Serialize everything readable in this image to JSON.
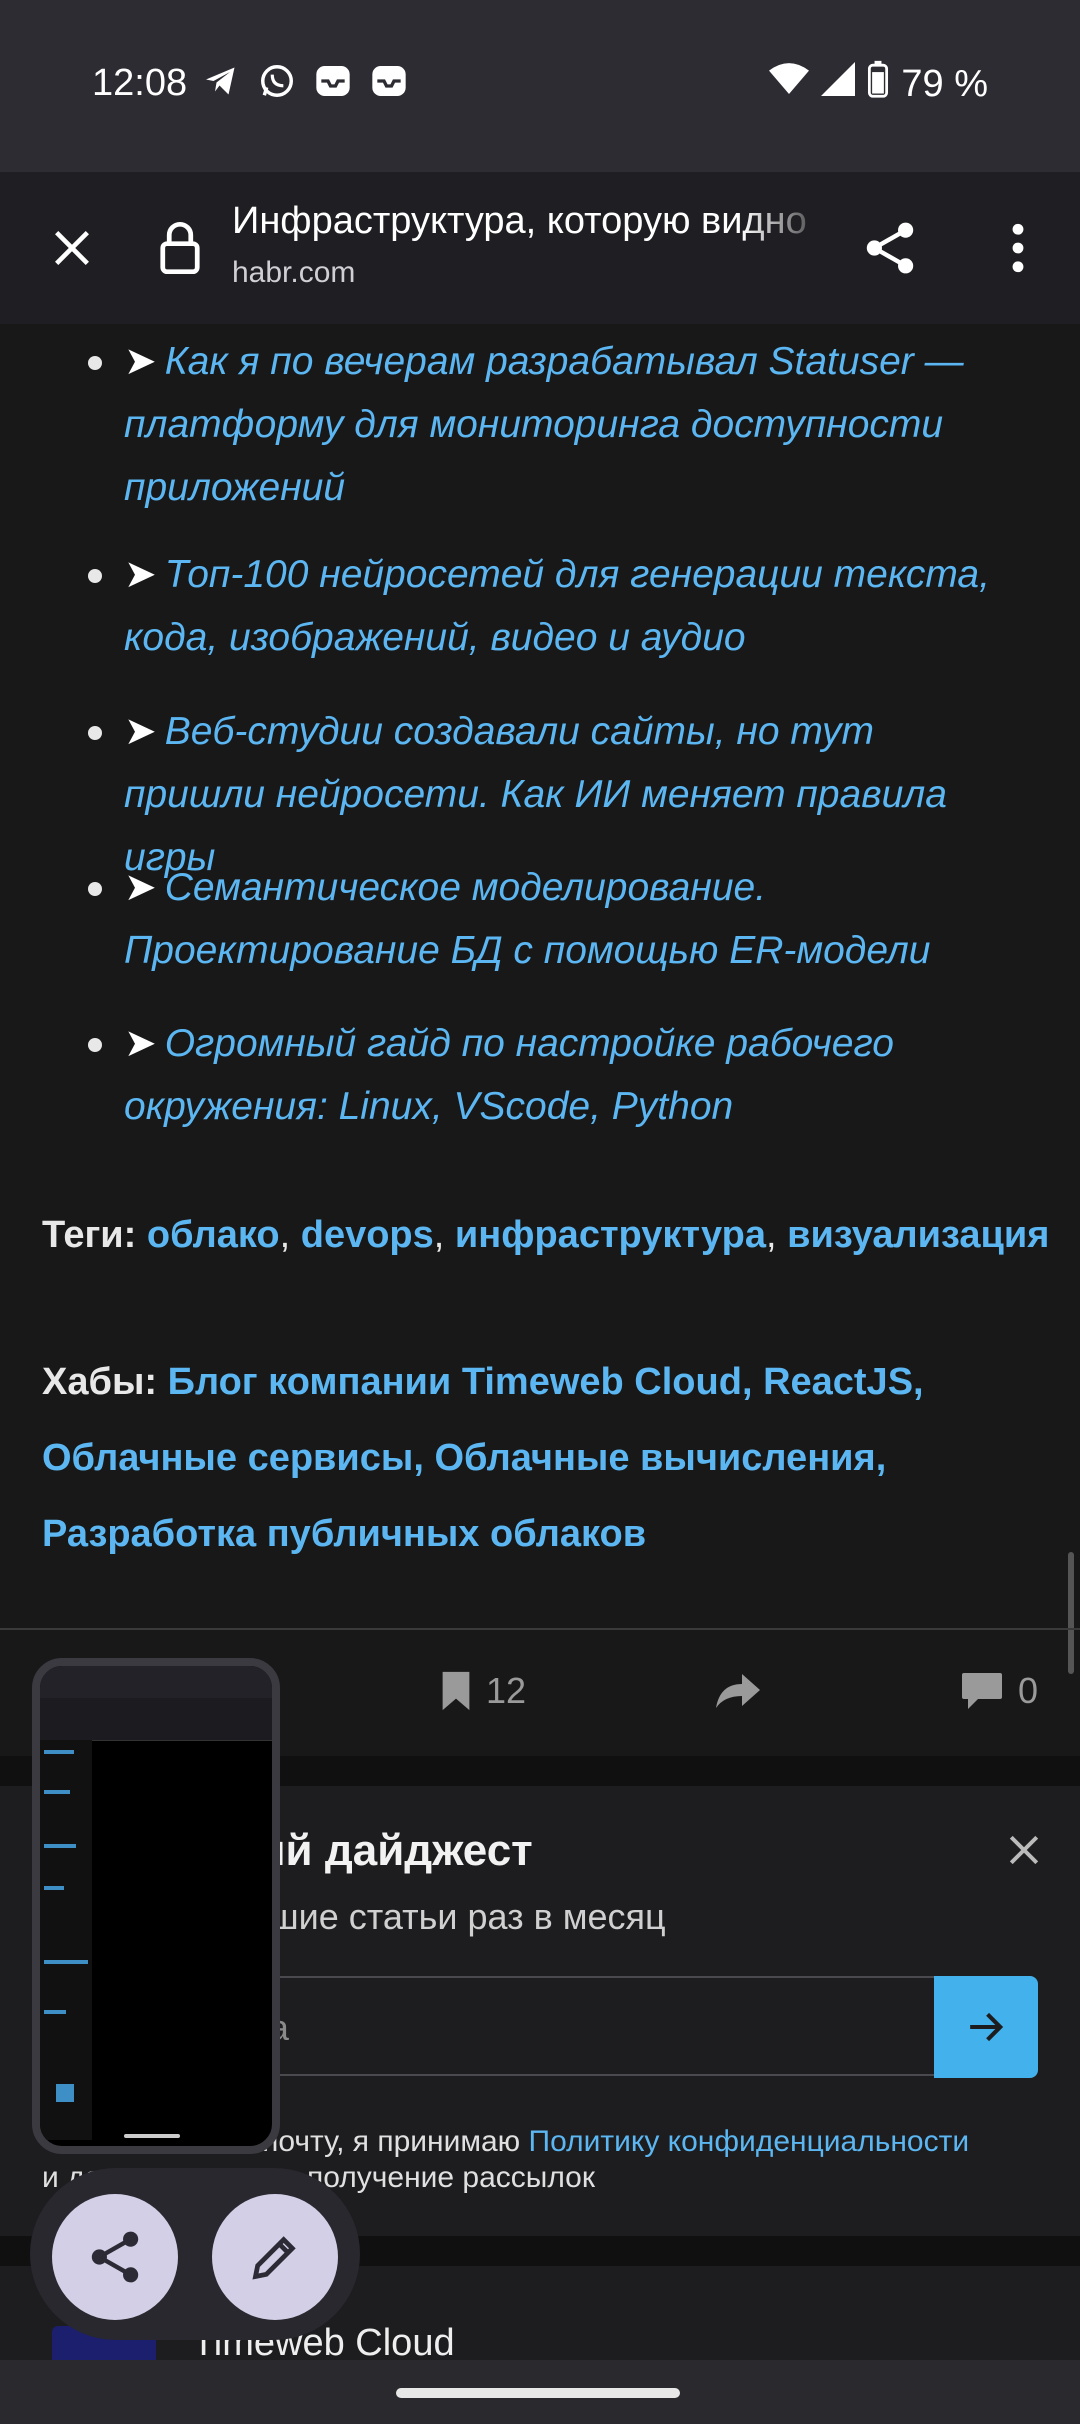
{
  "status_bar": {
    "time": "12:08",
    "notification_icons": [
      "telegram-icon",
      "whatsapp-icon",
      "inbox-icon",
      "inbox-icon"
    ],
    "battery": "79 %"
  },
  "toolbar": {
    "title": "Инфраструктура, которую видно",
    "domain": "habr.com"
  },
  "links": [
    {
      "arrow": "➤",
      "text": "Как я по вечерам разрабатывал Statuser — платформу для мониторинга доступности приложений"
    },
    {
      "arrow": "➤",
      "text": "Топ-100 нейросетей для генерации текста, кода, изображений, видео и аудио"
    },
    {
      "arrow": "➤",
      "text": "Веб-студии создавали сайты, но тут пришли нейросети. Как ИИ меняет правила игры"
    },
    {
      "arrow": "➤",
      "text": "Семантическое моделирование. Проектирование БД с помощью ER-модели"
    },
    {
      "arrow": "➤",
      "text": "Огромный гайд по настройке рабочего окружения: Linux, VScode, Python"
    }
  ],
  "tags": {
    "label": "Теги:",
    "items": [
      "облако",
      "devops",
      "инфраструктура",
      "визуализация"
    ]
  },
  "hubs": {
    "label": "Хабы:",
    "items": [
      "Блог компании Timeweb Cloud",
      "ReactJS",
      "Облачные сервисы",
      "Облачные вычисления",
      "Разработка публичных облаков"
    ]
  },
  "actions": {
    "bookmarks": "12",
    "comments": "0"
  },
  "digest": {
    "title": "ский дайджест",
    "subtitle": "лучшие статьи раз в месяц",
    "email_placeholder": "чта",
    "consent_prefix": "Оставляя свою почту, я принимаю",
    "privacy_link": "Политику конфиденциальности",
    "consent_suffix": "и даю согласие на получение рассылок"
  },
  "company": {
    "name": "Timeweb Cloud"
  },
  "colors": {
    "link": "#5bb6f2",
    "background": "#181818",
    "accent_button": "#43b1eb",
    "fab": "#d2cfe6"
  }
}
